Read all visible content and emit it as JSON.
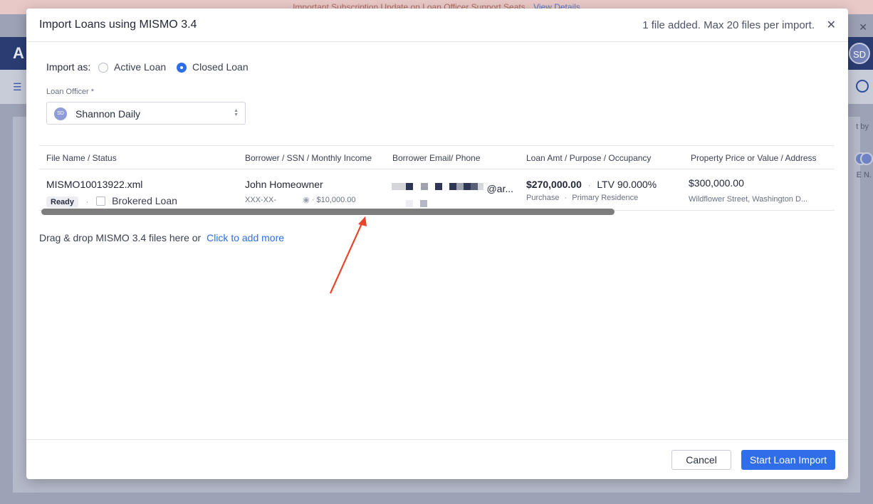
{
  "background": {
    "banner_text": "Important Subscription Update on Loan Officer Support Seats",
    "banner_link": "View Details",
    "logo_letter": "A",
    "avatar_initials": "SD",
    "sort_text": "t by",
    "name_stub": "E N."
  },
  "modal": {
    "title": "Import Loans using MISMO 3.4",
    "file_count_text": "1 file added. Max 20 files per import.",
    "close_glyph": "✕",
    "import_as_label": "Import as:",
    "options": [
      {
        "label": "Active Loan",
        "selected": false
      },
      {
        "label": "Closed Loan",
        "selected": true
      }
    ],
    "loan_officer": {
      "label": "Loan Officer *",
      "avatar": "SD",
      "value": "Shannon Daily"
    },
    "table": {
      "headers": [
        "File Name / Status",
        "Borrower / SSN / Monthly Income",
        "Borrower Email/ Phone",
        "Loan Amt / Purpose / Occupancy",
        "Property Price or Value / Address"
      ],
      "rows": [
        {
          "file_name": "MISMO10013922.xml",
          "status": "Ready",
          "brokered_label": "Brokered Loan",
          "borrower": "John Homeowner",
          "ssn": "XXX-XX-",
          "income": "$10,000.00",
          "email_suffix": "@ar...",
          "loan_amount": "$270,000.00",
          "ltv": "LTV 90.000%",
          "purpose": "Purchase",
          "occupancy": "Primary Residence",
          "property_price": "$300,000.00",
          "address": "Wildflower Street, Washington D..."
        }
      ]
    },
    "drop_text": "Drag & drop MISMO 3.4 files here or",
    "drop_link": "Click to add more",
    "cancel_label": "Cancel",
    "start_label": "Start Loan Import"
  },
  "colors": {
    "accent": "#2f6ee8",
    "arrow": "#e8452c",
    "header_bg": "#2a3d73"
  }
}
